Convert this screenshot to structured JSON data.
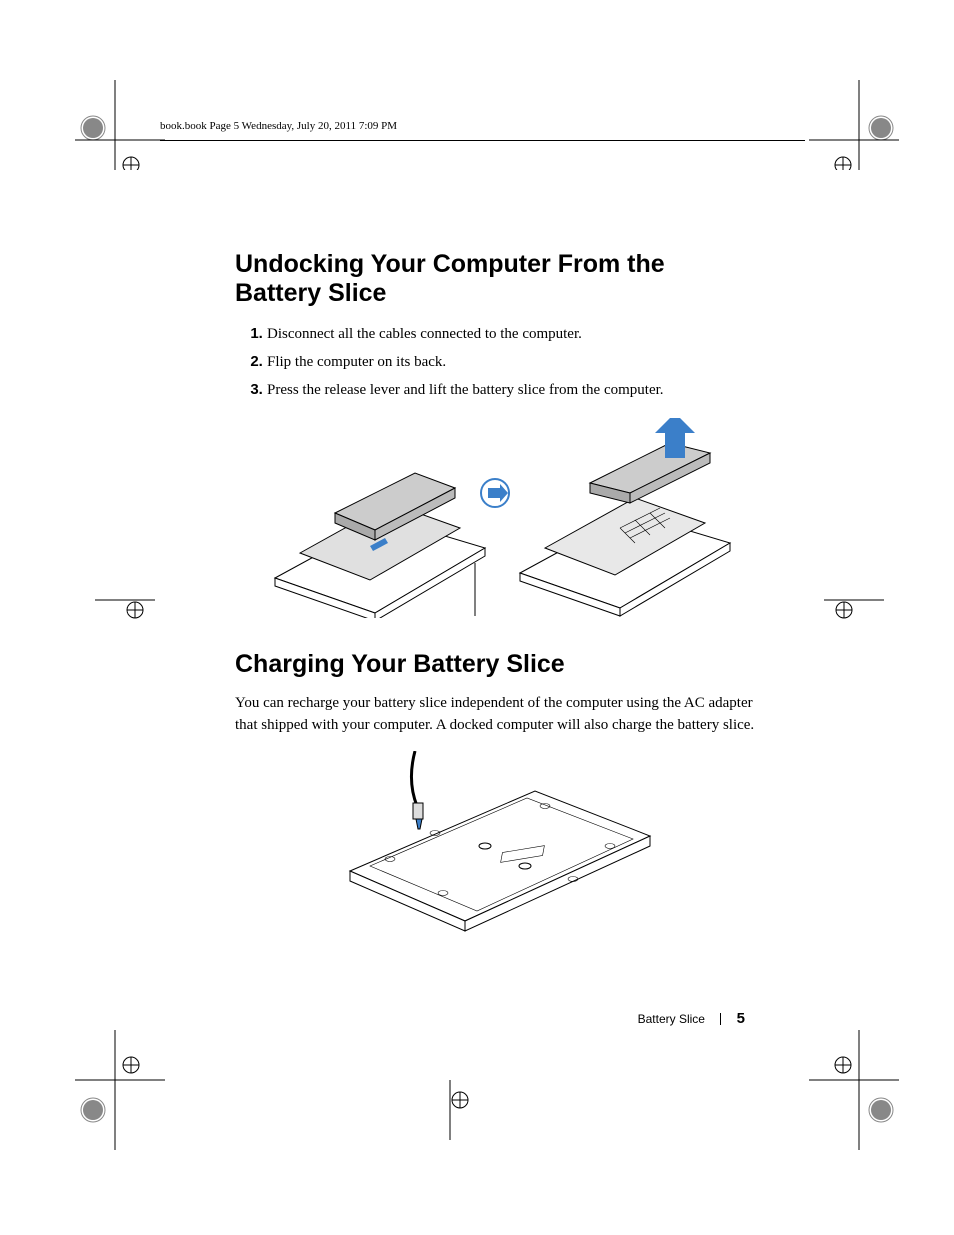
{
  "header_running": "book.book  Page 5  Wednesday, July 20, 2011  7:09 PM",
  "section1": {
    "heading": "Undocking Your Computer From the Battery Slice",
    "steps": [
      "Disconnect all the cables connected to the computer.",
      "Flip the computer on its back.",
      "Press the release lever and lift the battery slice from the computer."
    ]
  },
  "section2": {
    "heading": "Charging Your Battery Slice",
    "paragraph": "You can recharge your battery slice independent of the computer using the AC adapter that shipped with your computer. A docked computer will also charge the battery slice."
  },
  "footer": {
    "label": "Battery Slice",
    "page_number": "5"
  }
}
